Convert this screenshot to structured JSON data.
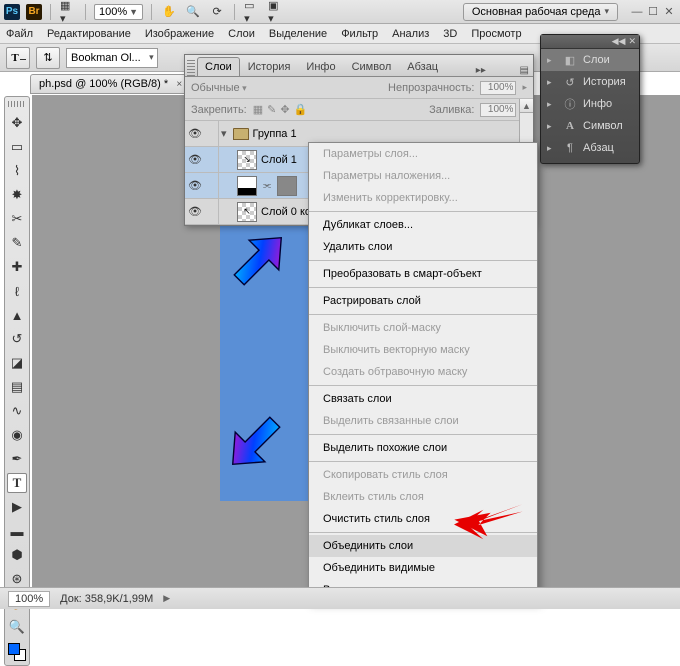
{
  "app_bar": {
    "zoom": "100%",
    "workspace_label": "Основная рабочая среда"
  },
  "menu": {
    "file": "Файл",
    "edit": "Редактирование",
    "image": "Изображение",
    "layer": "Слои",
    "select": "Выделение",
    "filter": "Фильтр",
    "analysis": "Анализ",
    "view_3d": "3D",
    "view": "Просмотр"
  },
  "options": {
    "font": "Bookman Ol..."
  },
  "doc_tab": "ph.psd @ 100% (RGB/8) *",
  "layers_panel": {
    "tabs": [
      "Слои",
      "История",
      "Инфо",
      "Символ",
      "Абзац"
    ],
    "blend_label": "Обычные",
    "opacity_label": "Непрозрачность:",
    "opacity_value": "100%",
    "lock_label": "Закрепить:",
    "fill_label": "Заливка:",
    "fill_value": "100%",
    "rows": [
      {
        "name": "Группа 1"
      },
      {
        "name": "Слой 1"
      },
      {
        "name": ""
      },
      {
        "name": "Слой 0 копи..."
      }
    ]
  },
  "context_menu": {
    "items": [
      {
        "label": "Параметры слоя...",
        "enabled": false
      },
      {
        "label": "Параметры наложения...",
        "enabled": false
      },
      {
        "label": "Изменить корректировку...",
        "enabled": false
      },
      {
        "sep": true
      },
      {
        "label": "Дубликат слоев...",
        "enabled": true
      },
      {
        "label": "Удалить слои",
        "enabled": true
      },
      {
        "sep": true
      },
      {
        "label": "Преобразовать в смарт-объект",
        "enabled": true
      },
      {
        "sep": true
      },
      {
        "label": "Растрировать слой",
        "enabled": true
      },
      {
        "sep": true
      },
      {
        "label": "Выключить слой-маску",
        "enabled": false
      },
      {
        "label": "Выключить векторную маску",
        "enabled": false
      },
      {
        "label": "Создать обтравочную маску",
        "enabled": false
      },
      {
        "sep": true
      },
      {
        "label": "Связать слои",
        "enabled": true
      },
      {
        "label": "Выделить связанные слои",
        "enabled": false
      },
      {
        "sep": true
      },
      {
        "label": "Выделить похожие слои",
        "enabled": true
      },
      {
        "sep": true
      },
      {
        "label": "Скопировать стиль слоя",
        "enabled": false
      },
      {
        "label": "Вклеить стиль слоя",
        "enabled": false
      },
      {
        "label": "Очистить стиль слоя",
        "enabled": true
      },
      {
        "sep": true
      },
      {
        "label": "Объединить слои",
        "enabled": true,
        "highlight": true
      },
      {
        "label": "Объединить видимые",
        "enabled": true
      },
      {
        "label": "Выполнить сведение",
        "enabled": true
      }
    ]
  },
  "icon_well": {
    "items": [
      {
        "label": "Слои",
        "active": true
      },
      {
        "label": "История",
        "active": false
      },
      {
        "label": "Инфо",
        "active": false
      },
      {
        "label": "Символ",
        "active": false
      },
      {
        "label": "Абзац",
        "active": false
      }
    ]
  },
  "status": {
    "zoom": "100%",
    "doc_size_label": "Док:",
    "doc_size": "358,9K/1,99M"
  }
}
